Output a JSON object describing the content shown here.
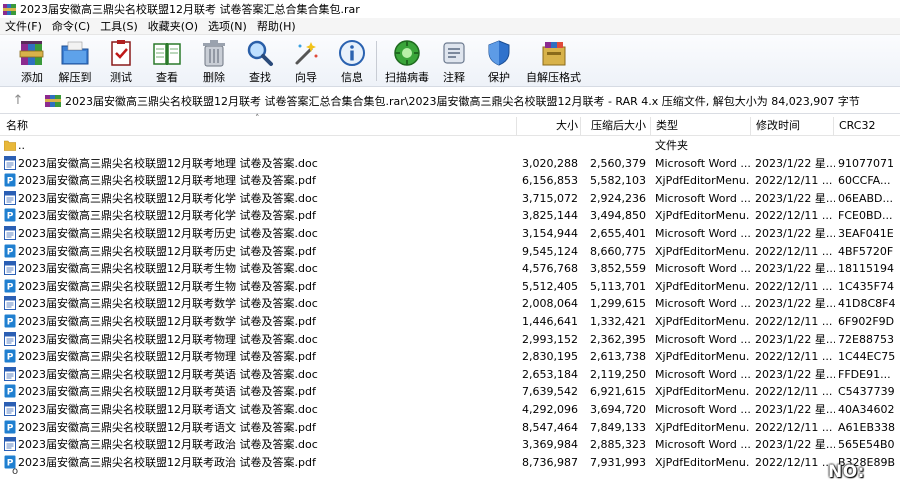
{
  "window": {
    "title": "2023届安徽高三鼎尖名校联盟12月联考 试卷答案汇总合集合集包.rar"
  },
  "menu": [
    "文件(F)",
    "命令(C)",
    "工具(S)",
    "收藏夹(O)",
    "选项(N)",
    "帮助(H)"
  ],
  "toolbar": {
    "add": "添加",
    "extract_to": "解压到",
    "test": "测试",
    "view": "查看",
    "delete": "删除",
    "find": "查找",
    "wizard": "向导",
    "info": "信息",
    "virus_scan": "扫描病毒",
    "comment": "注释",
    "protect": "保护",
    "sfx": "自解压格式"
  },
  "address": {
    "path": "2023届安徽高三鼎尖名校联盟12月联考 试卷答案汇总合集合集包.rar\\2023届安徽高三鼎尖名校联盟12月联考 - RAR 4.x 压缩文件, 解包大小为 84,023,907 字节"
  },
  "columns": {
    "name": "名称",
    "size": "大小",
    "packed": "压缩后大小",
    "type": "类型",
    "modified": "修改时间",
    "crc": "CRC32"
  },
  "parent_row": {
    "name": "..",
    "type": "文件夹"
  },
  "files": [
    {
      "name": "2023届安徽高三鼎尖名校联盟12月联考地理 试卷及答案.doc",
      "kind": "doc",
      "size": "3,020,288",
      "packed": "2,560,379",
      "type": "Microsoft Word ...",
      "date": "2023/1/22 星...",
      "crc": "91077071"
    },
    {
      "name": "2023届安徽高三鼎尖名校联盟12月联考地理 试卷及答案.pdf",
      "kind": "pdf",
      "size": "6,156,853",
      "packed": "5,582,103",
      "type": "XjPdfEditorMenu...",
      "date": "2022/12/11 ...",
      "crc": "60CCFA..."
    },
    {
      "name": "2023届安徽高三鼎尖名校联盟12月联考化学 试卷及答案.doc",
      "kind": "doc",
      "size": "3,715,072",
      "packed": "2,924,236",
      "type": "Microsoft Word ...",
      "date": "2023/1/22 星...",
      "crc": "06EABD..."
    },
    {
      "name": "2023届安徽高三鼎尖名校联盟12月联考化学 试卷及答案.pdf",
      "kind": "pdf",
      "size": "3,825,144",
      "packed": "3,494,850",
      "type": "XjPdfEditorMenu...",
      "date": "2022/12/11 ...",
      "crc": "FCE0BD..."
    },
    {
      "name": "2023届安徽高三鼎尖名校联盟12月联考历史 试卷及答案.doc",
      "kind": "doc",
      "size": "3,154,944",
      "packed": "2,655,401",
      "type": "Microsoft Word ...",
      "date": "2023/1/22 星...",
      "crc": "3EAF041E"
    },
    {
      "name": "2023届安徽高三鼎尖名校联盟12月联考历史 试卷及答案.pdf",
      "kind": "pdf",
      "size": "9,545,124",
      "packed": "8,660,775",
      "type": "XjPdfEditorMenu...",
      "date": "2022/12/11 ...",
      "crc": "4BF5720F"
    },
    {
      "name": "2023届安徽高三鼎尖名校联盟12月联考生物 试卷及答案.doc",
      "kind": "doc",
      "size": "4,576,768",
      "packed": "3,852,559",
      "type": "Microsoft Word ...",
      "date": "2023/1/22 星...",
      "crc": "18115194"
    },
    {
      "name": "2023届安徽高三鼎尖名校联盟12月联考生物 试卷及答案.pdf",
      "kind": "pdf",
      "size": "5,512,405",
      "packed": "5,113,701",
      "type": "XjPdfEditorMenu...",
      "date": "2022/12/11 ...",
      "crc": "1C435F74"
    },
    {
      "name": "2023届安徽高三鼎尖名校联盟12月联考数学 试卷及答案.doc",
      "kind": "doc",
      "size": "2,008,064",
      "packed": "1,299,615",
      "type": "Microsoft Word ...",
      "date": "2023/1/22 星...",
      "crc": "41D8C8F4"
    },
    {
      "name": "2023届安徽高三鼎尖名校联盟12月联考数学 试卷及答案.pdf",
      "kind": "pdf",
      "size": "1,446,641",
      "packed": "1,332,421",
      "type": "XjPdfEditorMenu...",
      "date": "2022/12/11 ...",
      "crc": "6F902F9D"
    },
    {
      "name": "2023届安徽高三鼎尖名校联盟12月联考物理 试卷及答案.doc",
      "kind": "doc",
      "size": "2,993,152",
      "packed": "2,362,395",
      "type": "Microsoft Word ...",
      "date": "2023/1/22 星...",
      "crc": "72E88753"
    },
    {
      "name": "2023届安徽高三鼎尖名校联盟12月联考物理 试卷及答案.pdf",
      "kind": "pdf",
      "size": "2,830,195",
      "packed": "2,613,738",
      "type": "XjPdfEditorMenu...",
      "date": "2022/12/11 ...",
      "crc": "1C44EC75"
    },
    {
      "name": "2023届安徽高三鼎尖名校联盟12月联考英语 试卷及答案.doc",
      "kind": "doc",
      "size": "2,653,184",
      "packed": "2,119,250",
      "type": "Microsoft Word ...",
      "date": "2023/1/22 星...",
      "crc": "FFDE91..."
    },
    {
      "name": "2023届安徽高三鼎尖名校联盟12月联考英语 试卷及答案.pdf",
      "kind": "pdf",
      "size": "7,639,542",
      "packed": "6,921,615",
      "type": "XjPdfEditorMenu...",
      "date": "2022/12/11 ...",
      "crc": "C5437739"
    },
    {
      "name": "2023届安徽高三鼎尖名校联盟12月联考语文 试卷及答案.doc",
      "kind": "doc",
      "size": "4,292,096",
      "packed": "3,694,720",
      "type": "Microsoft Word ...",
      "date": "2023/1/22 星...",
      "crc": "40A34602"
    },
    {
      "name": "2023届安徽高三鼎尖名校联盟12月联考语文 试卷及答案.pdf",
      "kind": "pdf",
      "size": "8,547,464",
      "packed": "7,849,133",
      "type": "XjPdfEditorMenu...",
      "date": "2022/12/11 ...",
      "crc": "A61EB338"
    },
    {
      "name": "2023届安徽高三鼎尖名校联盟12月联考政治 试卷及答案.doc",
      "kind": "doc",
      "size": "3,369,984",
      "packed": "2,885,323",
      "type": "Microsoft Word ...",
      "date": "2023/1/22 星...",
      "crc": "565E54B0"
    },
    {
      "name": "2023届安徽高三鼎尖名校联盟12月联考政治 试卷及答案.pdf",
      "kind": "pdf",
      "size": "8,736,987",
      "packed": "7,931,993",
      "type": "XjPdfEditorMenu...",
      "date": "2022/12/11 ...",
      "crc": "B328E89B"
    }
  ],
  "status": {
    "mark": "o"
  },
  "watermark": "NO:",
  "colors": {
    "doc_icon": "#2b5fb4",
    "pdf_icon": "#1f7fd0",
    "folder": "#e8b83a"
  }
}
